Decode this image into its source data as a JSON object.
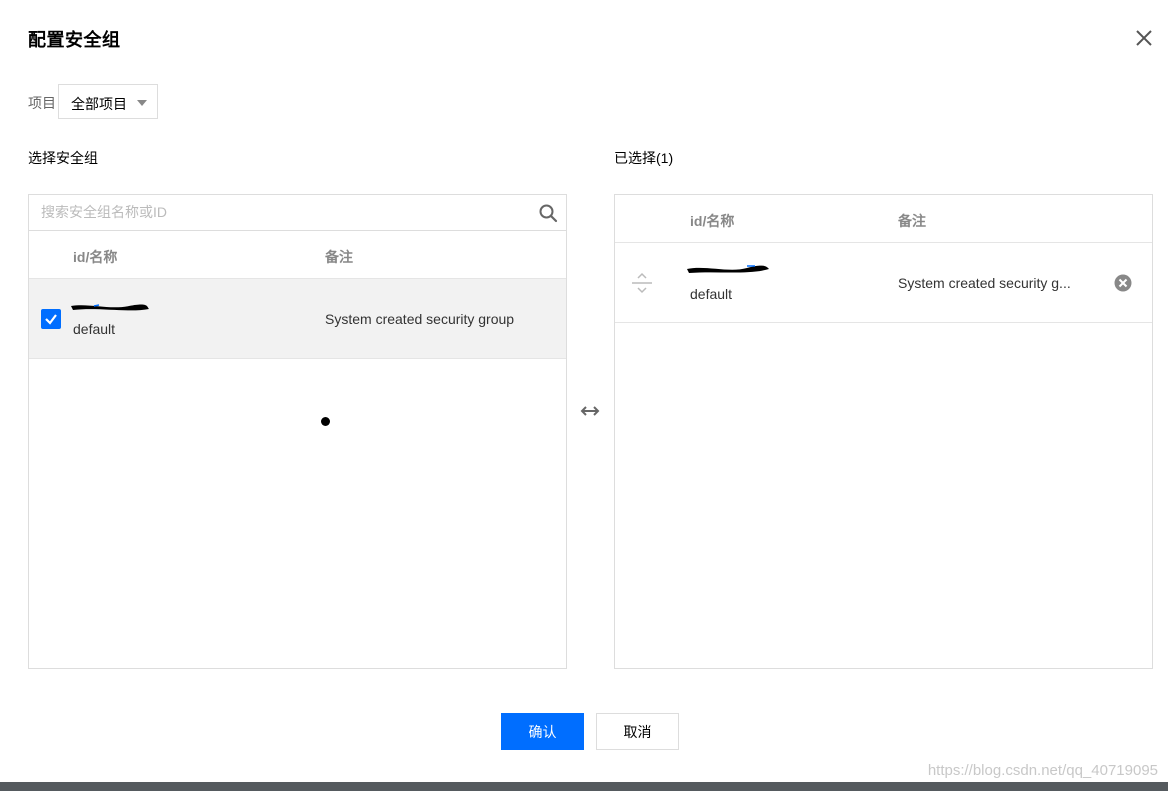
{
  "dialog": {
    "title": "配置安全组",
    "project_label": "项目",
    "project_selected": "全部项目"
  },
  "left_panel": {
    "label": "选择安全组",
    "search_placeholder": "搜索安全组名称或ID",
    "col_name": "id/名称",
    "col_note": "备注",
    "rows": [
      {
        "name": "default",
        "note": "System created security group",
        "checked": true
      }
    ]
  },
  "right_panel": {
    "label": "已选择(1)",
    "col_name": "id/名称",
    "col_note": "备注",
    "rows": [
      {
        "name": "default",
        "note": "System created security g..."
      }
    ]
  },
  "footer": {
    "confirm_label": "确认",
    "cancel_label": "取消"
  },
  "watermark": "https://blog.csdn.net/qq_40719095",
  "colors": {
    "primary": "#006eff",
    "link": "#006eff",
    "border": "#dddddd",
    "selected_row": "#f2f2f2"
  },
  "icons": {
    "close": "close-icon",
    "search": "search-icon",
    "dropdown": "caret-down-icon",
    "transfer": "swap-horizontal-icon",
    "drag": "drag-handle-icon",
    "remove": "remove-circle-icon",
    "check": "check-icon"
  }
}
